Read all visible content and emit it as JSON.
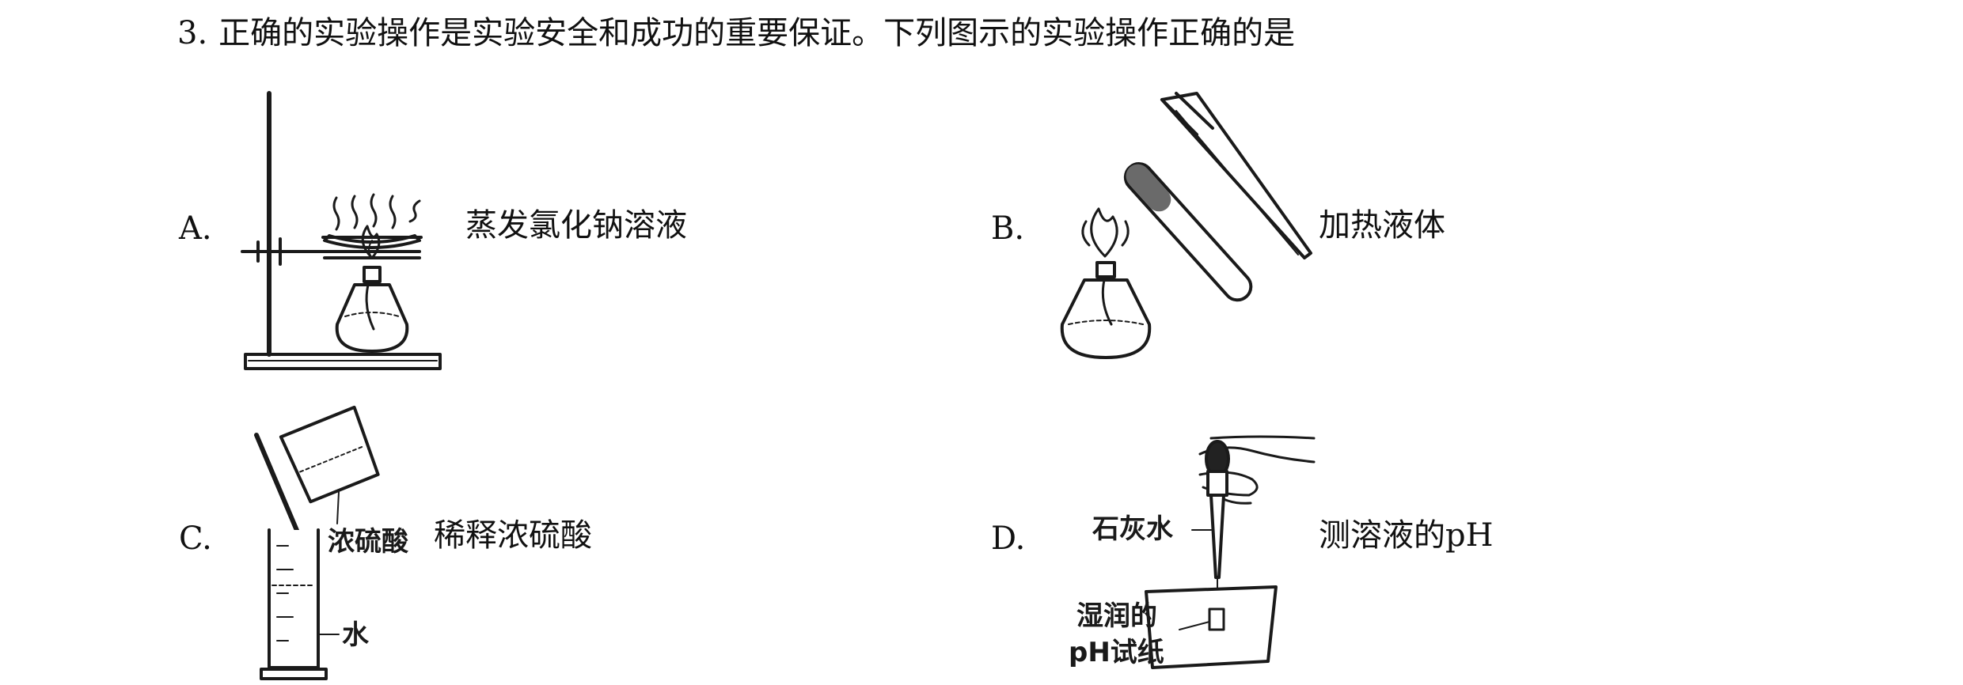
{
  "question": {
    "number": "3.",
    "text": "正确的实验操作是实验安全和成功的重要保证。下列图示的实验操作正确的是"
  },
  "options": [
    {
      "letter": "A.",
      "text": "蒸发氯化钠溶液",
      "figure_icon": "evaporating-dish-on-ring-stand-icon"
    },
    {
      "letter": "B.",
      "text": "加热液体",
      "figure_icon": "test-tube-over-alcohol-lamp-icon"
    },
    {
      "letter": "C.",
      "text": "稀释浓硫酸",
      "figure_icon": "pour-acid-into-graduated-cylinder-icon"
    },
    {
      "letter": "D.",
      "text": "测溶液的pH",
      "figure_icon": "dropper-on-ph-paper-icon"
    }
  ],
  "figure_labels": {
    "c_acid": "浓硫酸",
    "c_water": "水",
    "d_limewater": "石灰水",
    "d_paper_line1": "湿润的",
    "d_paper_line2": "pH试纸"
  }
}
